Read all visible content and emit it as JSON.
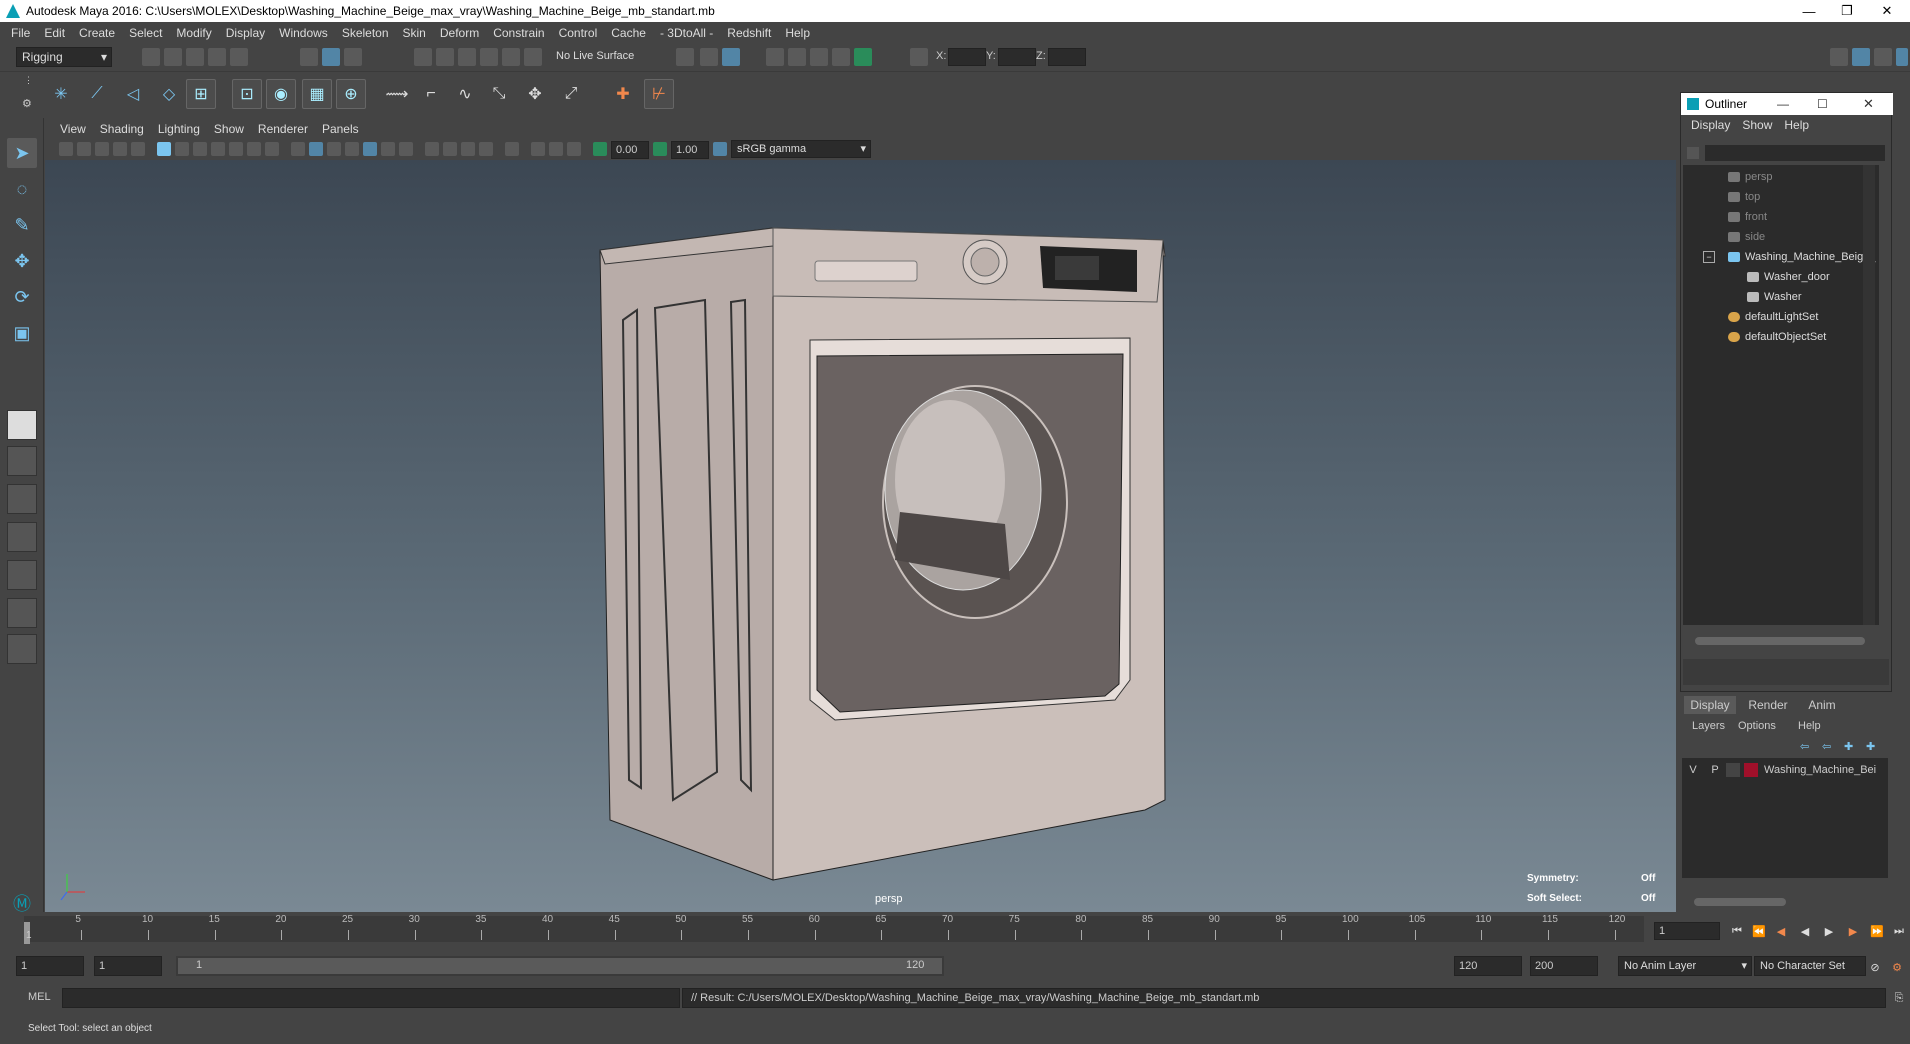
{
  "window": {
    "title": "Autodesk Maya 2016: C:\\Users\\MOLEX\\Desktop\\Washing_Machine_Beige_max_vray\\Washing_Machine_Beige_mb_standart.mb",
    "minimize": "—",
    "restore": "❐",
    "close": "✕"
  },
  "menubar": [
    "File",
    "Edit",
    "Create",
    "Select",
    "Modify",
    "Display",
    "Windows",
    "Skeleton",
    "Skin",
    "Deform",
    "Constrain",
    "Control",
    "Cache",
    "- 3DtoAll -",
    "Redshift",
    "Help"
  ],
  "shelf": {
    "mode": "Rigging",
    "live_surface": "No Live Surface",
    "x_label": "X:",
    "y_label": "Y:",
    "z_label": "Z:"
  },
  "viewport": {
    "menu": [
      "View",
      "Shading",
      "Lighting",
      "Show",
      "Renderer",
      "Panels"
    ],
    "exposure": "0.00",
    "gamma": "1.00",
    "color_space": "sRGB gamma",
    "camera_label": "persp",
    "symmetry_label": "Symmetry:",
    "symmetry_value": "Off",
    "soft_select_label": "Soft Select:",
    "soft_select_value": "Off"
  },
  "outliner": {
    "title": "Outliner",
    "menu": [
      "Display",
      "Show",
      "Help"
    ],
    "items": [
      {
        "label": "persp",
        "icon": "camera-icon",
        "dim": true
      },
      {
        "label": "top",
        "icon": "camera-icon",
        "dim": true
      },
      {
        "label": "front",
        "icon": "camera-icon",
        "dim": true
      },
      {
        "label": "side",
        "icon": "camera-icon",
        "dim": true
      },
      {
        "label": "Washing_Machine_Beige_",
        "icon": "group-icon",
        "dim": false
      },
      {
        "label": "Washer_door",
        "icon": "mesh-icon",
        "dim": false
      },
      {
        "label": "Washer",
        "icon": "mesh-icon",
        "dim": false
      },
      {
        "label": "defaultLightSet",
        "icon": "set-icon",
        "dim": false
      },
      {
        "label": "defaultObjectSet",
        "icon": "set-icon",
        "dim": false
      }
    ]
  },
  "layers": {
    "tabs": [
      "Display",
      "Render",
      "Anim"
    ],
    "menu": [
      "Layers",
      "Options",
      "Help"
    ],
    "row": {
      "v": "V",
      "p": "P",
      "name": "Washing_Machine_Bei",
      "color": "#a0102a"
    }
  },
  "timeline": {
    "ticks": [
      "5",
      "10",
      "15",
      "20",
      "25",
      "30",
      "35",
      "40",
      "45",
      "50",
      "55",
      "60",
      "65",
      "70",
      "75",
      "80",
      "85",
      "90",
      "95",
      "100",
      "105",
      "110",
      "115",
      "120"
    ],
    "start_marker": "1",
    "current_frame": "1"
  },
  "range": {
    "start": "1",
    "playback_start": "1",
    "slider_start": "1",
    "slider_end": "120",
    "playback_end": "120",
    "end": "200",
    "anim_layer": "No Anim Layer",
    "character_set": "No Character Set"
  },
  "command": {
    "lang": "MEL",
    "result": "// Result: C:/Users/MOLEX/Desktop/Washing_Machine_Beige_max_vray/Washing_Machine_Beige_mb_standart.mb"
  },
  "helpline": "Select Tool: select an object",
  "colors": {
    "accent": "#5285a6",
    "lock_red": "#a0102a",
    "maya_teal": "#0a9fb5"
  }
}
